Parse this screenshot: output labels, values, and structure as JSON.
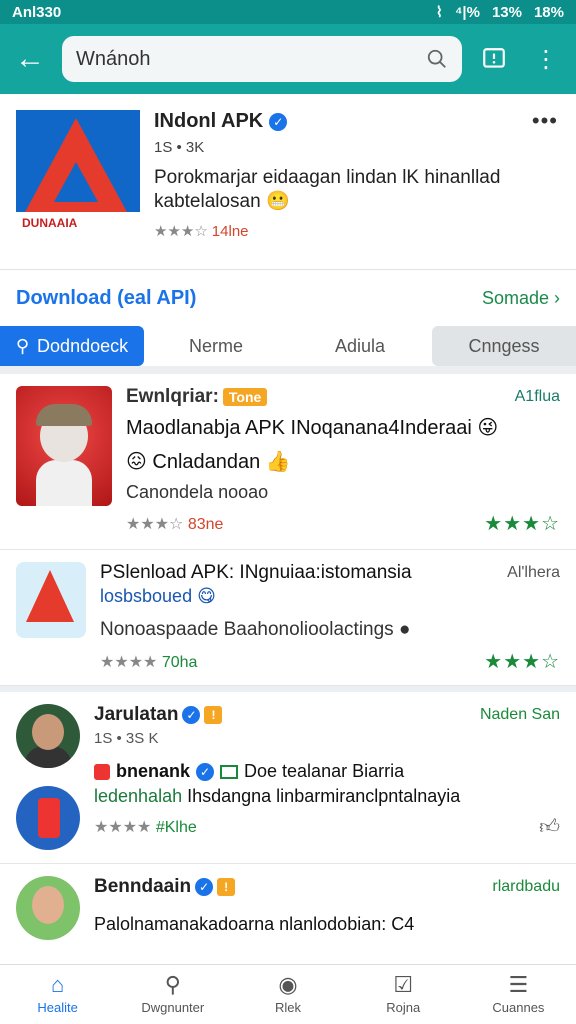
{
  "status": {
    "left": "Anl330",
    "right_signal": "⁴|%",
    "right_batt": "13%",
    "right_pct": "18%"
  },
  "search": {
    "value": "Wnánoh"
  },
  "featured": {
    "title": "INdonl APK",
    "meta": "1S • 3K",
    "desc": "Porokmarjar eidaagan lindan lK hinanllad kabtelalosan",
    "emoji": "😬",
    "rating_value": "14lne"
  },
  "section": {
    "left": "Download (eal API)",
    "right": "Somade"
  },
  "tabs": [
    {
      "label": "Dodndoeck"
    },
    {
      "label": "Nerme"
    },
    {
      "label": "Adiula"
    },
    {
      "label": "Cnngess"
    }
  ],
  "item1": {
    "label": "Ewnlqriar:",
    "pill": "Tone",
    "top_right": "A1flua",
    "line": "Maodlanabja APK INoqanana4Inderaai 😜",
    "line_b": "😖 Cnladandan 👍",
    "line3": "Canondela nooao",
    "rating_value": "83ne"
  },
  "item2": {
    "title": "PSlenload APK: INgnuiaa:istomansia",
    "sub": "losbsboued 😋",
    "top_right": "Al'lhera",
    "line": "Nonoaspaade Baahonolioolactings ●",
    "rating_value": "70ha"
  },
  "post1": {
    "name": "Jarulatan",
    "meta": "1S • 3S K",
    "top_right": "Naden San",
    "line_a": "bnenank",
    "line_b": "Doe tealanar Biarria",
    "line_c_green": "ledenhalah",
    "line_c": "Ihsdangna linbarmiranclpntalnayia",
    "rating_value": "#Klhe"
  },
  "post2": {
    "name": "Benndaain",
    "top_right": "rlardbadu",
    "line": "Palolnamanakadoarna nlanlodobian: C4"
  },
  "nav": [
    {
      "label": "Healite"
    },
    {
      "label": "Dwgnunter"
    },
    {
      "label": "Rlek"
    },
    {
      "label": "Rojna"
    },
    {
      "label": "Cuannes"
    }
  ],
  "colors": {
    "topbar": "#14a59e",
    "accent": "#1a73e8",
    "green": "#1a8a3a"
  }
}
